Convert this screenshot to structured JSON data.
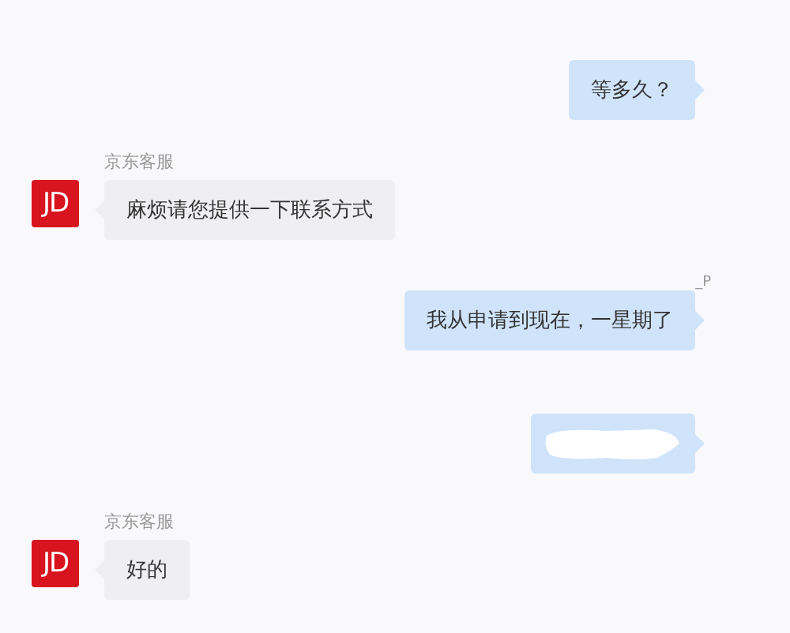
{
  "messages": [
    {
      "kind": "sent",
      "text": "等多久？"
    },
    {
      "kind": "received",
      "sender": "京东客服",
      "avatar": "JD",
      "text": "麻烦请您提供一下联系方式"
    },
    {
      "kind": "sent",
      "sender": "_P",
      "text": "我从申请到现在，一星期了"
    },
    {
      "kind": "redacted"
    },
    {
      "kind": "received",
      "sender": "京东客服",
      "avatar": "JD",
      "text": "好的"
    }
  ]
}
